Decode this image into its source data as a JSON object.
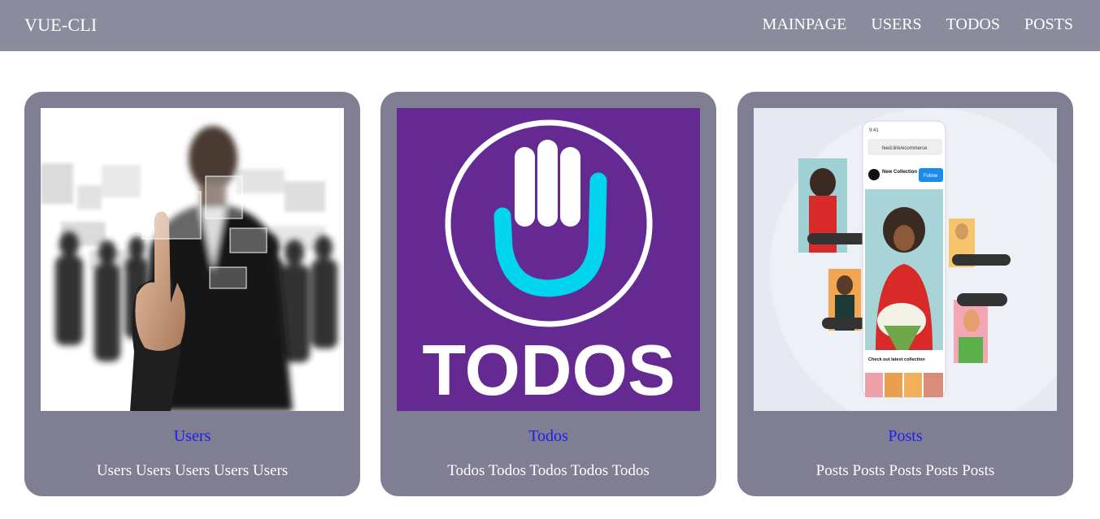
{
  "navbar": {
    "brand": "VUE-CLI",
    "links": [
      {
        "label": "MAINPAGE"
      },
      {
        "label": "USERS"
      },
      {
        "label": "TODOS"
      },
      {
        "label": "POSTS"
      }
    ]
  },
  "cards": [
    {
      "link": "Users",
      "description": "Users Users Users Users Users",
      "image_icon": "business-people-touchscreen-image"
    },
    {
      "link": "Todos",
      "description": "Todos Todos Todos Todos Todos",
      "image_icon": "todos-hand-logo",
      "logo_text": "TODOS"
    },
    {
      "link": "Posts",
      "description": "Posts Posts Posts Posts Posts",
      "image_icon": "social-posts-phone-image",
      "phone": {
        "time": "9:41",
        "url": "feed.link/ecommerce",
        "collection_title": "New Collection",
        "follow": "Follow",
        "caption": "Check out latest collection"
      }
    }
  ],
  "colors": {
    "navbar_bg": "#8a8b9d",
    "card_bg": "#7f7e92",
    "link": "#1d1ff0",
    "todos_purple": "#652a92",
    "todos_cyan": "#00d4ee"
  }
}
